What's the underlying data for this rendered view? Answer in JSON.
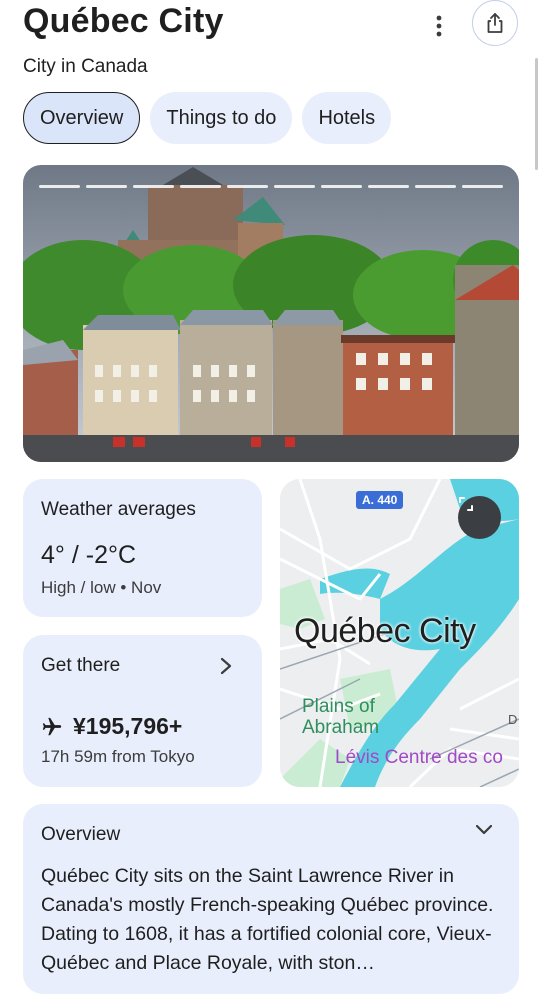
{
  "header": {
    "title": "Québec City",
    "subtitle": "City in Canada",
    "more_icon": "more-vert-icon",
    "share_icon": "share-icon"
  },
  "tabs": [
    {
      "label": "Overview",
      "active": true
    },
    {
      "label": "Things to do",
      "active": false
    },
    {
      "label": "Hotels",
      "active": false
    }
  ],
  "hero": {
    "image": "chateau-frontenac-photo",
    "story_segments": 10
  },
  "weather": {
    "heading": "Weather averages",
    "temps": "4° / -2°C",
    "meta": "High / low • Nov"
  },
  "get_there": {
    "heading": "Get there",
    "price": "¥195,796+",
    "meta": "17h 59m from Tokyo",
    "icon": "airplane-icon"
  },
  "map": {
    "city": "Québec City",
    "plains": "Plains of Abraham",
    "levis": "Lévis Centre des co",
    "highway": "A. 440",
    "edge_label": "D",
    "expand_icon": "expand-icon"
  },
  "overview": {
    "heading": "Overview",
    "text": "Québec City sits on the Saint Lawrence River in Canada's mostly French-speaking Québec province. Dating to 1608, it has a fortified colonial core, Vieux-Québec and Place Royale, with ston…"
  },
  "colors": {
    "card_bg": "#e8eefb",
    "tab_bg": "#e8eefb",
    "active_tab_bg": "#dbe5fa",
    "water": "#5ad0e0",
    "park": "#c9ecd2"
  }
}
